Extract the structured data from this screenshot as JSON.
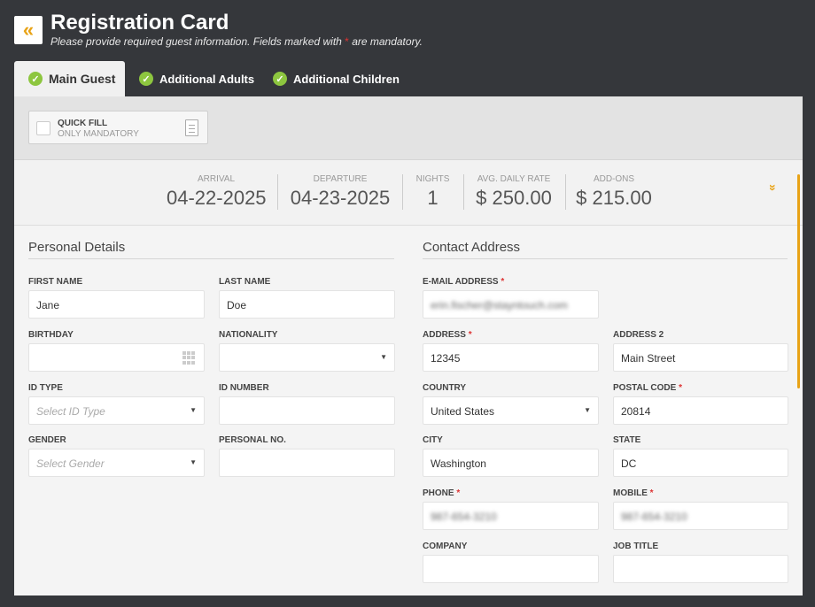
{
  "header": {
    "back_icon": "«",
    "title": "Registration Card",
    "subtitle_before": "Please provide required guest information. Fields marked with",
    "subtitle_asterisk": "*",
    "subtitle_after": "are mandatory."
  },
  "tabs": [
    {
      "label": "Main Guest",
      "active": true
    },
    {
      "label": "Additional Adults",
      "active": false
    },
    {
      "label": "Additional Children",
      "active": false
    }
  ],
  "quick_fill": {
    "label": "QUICK FILL",
    "sublabel": "ONLY MANDATORY"
  },
  "stay": {
    "arrival_label": "ARRIVAL",
    "arrival": "04-22-2025",
    "departure_label": "DEPARTURE",
    "departure": "04-23-2025",
    "nights_label": "NIGHTS",
    "nights": "1",
    "rate_label": "AVG. DAILY RATE",
    "rate": "$ 250.00",
    "addons_label": "ADD-ONS",
    "addons": "$ 215.00",
    "expand_icon": "»"
  },
  "personal": {
    "title": "Personal Details",
    "first_name_label": "FIRST NAME",
    "first_name": "Jane",
    "last_name_label": "LAST NAME",
    "last_name": "Doe",
    "birthday_label": "BIRTHDAY",
    "birthday": "",
    "nationality_label": "NATIONALITY",
    "nationality": "",
    "id_type_label": "ID TYPE",
    "id_type_placeholder": "Select ID Type",
    "id_number_label": "ID NUMBER",
    "id_number": "",
    "gender_label": "GENDER",
    "gender_placeholder": "Select Gender",
    "personal_no_label": "PERSONAL NO.",
    "personal_no": ""
  },
  "contact": {
    "title": "Contact Address",
    "email_label": "E-MAIL ADDRESS",
    "email": "erin.fischer@stayntouch.com",
    "address_label": "ADDRESS",
    "address": "12345",
    "address2_label": "ADDRESS 2",
    "address2": "Main Street",
    "country_label": "COUNTRY",
    "country": "United States",
    "postal_label": "POSTAL CODE",
    "postal": "20814",
    "city_label": "CITY",
    "city": "Washington",
    "state_label": "STATE",
    "state": "DC",
    "phone_label": "PHONE",
    "phone": "987-654-3210",
    "mobile_label": "MOBILE",
    "mobile": "987-654-3210",
    "company_label": "COMPANY",
    "company": "",
    "job_title_label": "JOB TITLE",
    "job_title": ""
  },
  "required_marker": "*",
  "colors": {
    "accent": "#e8a317",
    "check": "#8dc63f",
    "required": "#dd3333",
    "background": "#35373b"
  }
}
